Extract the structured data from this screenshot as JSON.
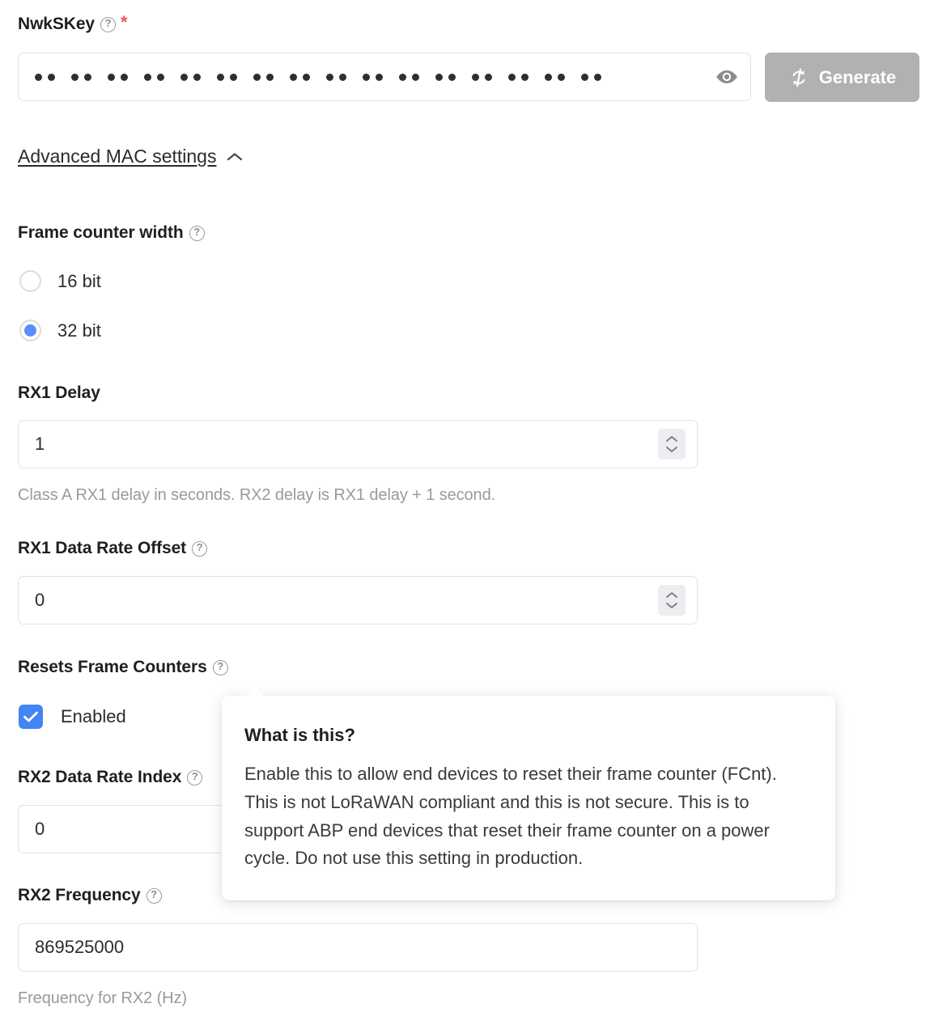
{
  "nwkskey": {
    "label": "NwkSKey",
    "required_marker": "*",
    "help_icon": "question-circle-icon",
    "masked_value_pairs": 16,
    "reveal_icon": "eye-icon",
    "generate_label": "Generate",
    "generate_icon": "refresh-cycle-icon"
  },
  "advanced": {
    "toggle_label": "Advanced MAC settings",
    "toggle_icon": "chevron-up-icon",
    "expanded": true
  },
  "frame_counter_width": {
    "label": "Frame counter width",
    "help_icon": "question-circle-icon",
    "options": [
      {
        "label": "16 bit",
        "selected": false
      },
      {
        "label": "32 bit",
        "selected": true
      }
    ]
  },
  "rx1_delay": {
    "label": "RX1 Delay",
    "value": "1",
    "helper": "Class A RX1 delay in seconds. RX2 delay is RX1 delay + 1 second.",
    "spinner_icon": "stepper-updown-icon"
  },
  "rx1_data_rate_offset": {
    "label": "RX1 Data Rate Offset",
    "help_icon": "question-circle-icon",
    "value": "0",
    "spinner_icon": "stepper-updown-icon"
  },
  "resets_frame_counters": {
    "label": "Resets Frame Counters",
    "help_icon": "question-circle-icon",
    "checkbox_label": "Enabled",
    "checked": true
  },
  "rx2_data_rate_index": {
    "label": "RX2 Data Rate Index",
    "help_icon": "question-circle-icon",
    "value": "0"
  },
  "rx2_frequency": {
    "label": "RX2 Frequency",
    "help_icon": "question-circle-icon",
    "value": "869525000",
    "helper": "Frequency for RX2 (Hz)"
  },
  "tooltip": {
    "title": "What is this?",
    "body": "Enable this to allow end devices to reset their frame counter (FCnt). This is not LoRaWAN compliant and this is not secure. This is to support ABP end devices that reset their frame counter on a power cycle. Do not use this setting in production."
  },
  "colors": {
    "accent_blue": "#4285f4",
    "radio_blue": "#5a8dfb",
    "required_red": "#f4564f",
    "button_gray": "#b1b1b1",
    "border_gray": "#e3e3e3",
    "helper_gray": "#9a9a9a"
  }
}
